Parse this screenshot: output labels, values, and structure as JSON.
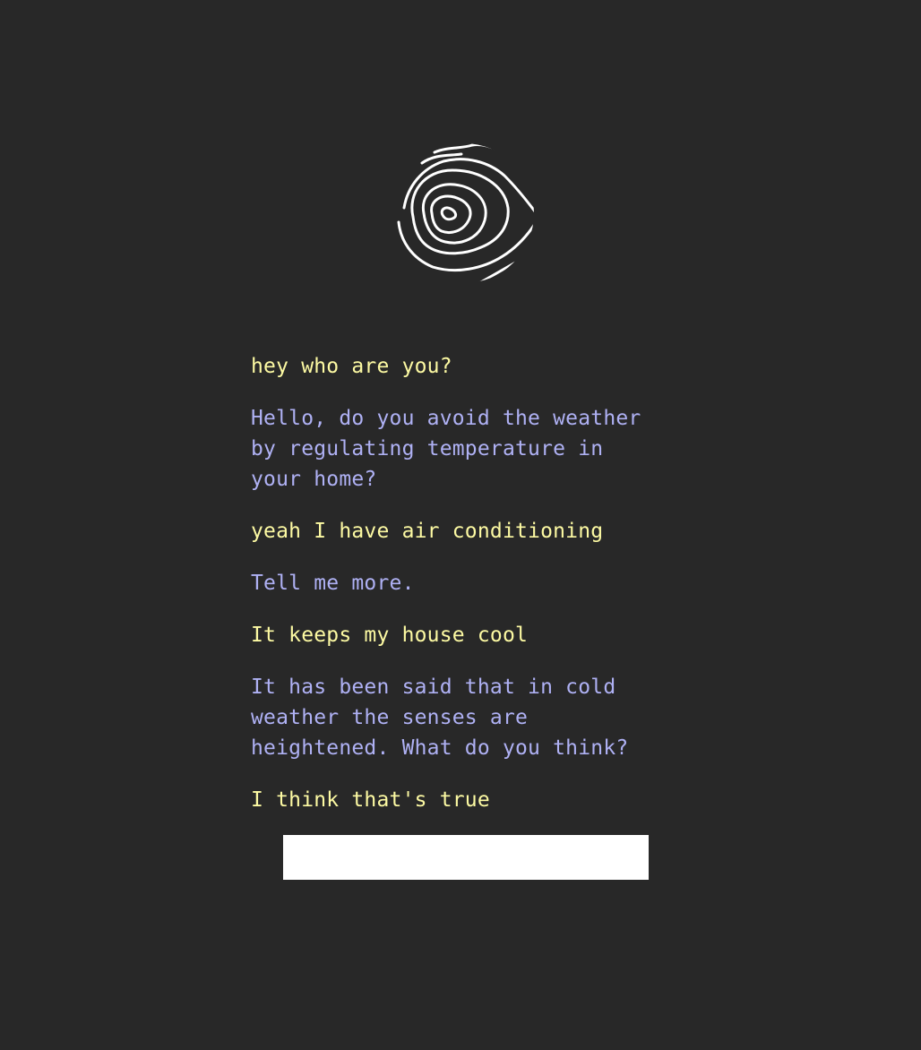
{
  "colors": {
    "background": "#282828",
    "user_text": "#fdfaa3",
    "bot_text": "#afb1f4",
    "input_background": "#ffffff"
  },
  "logo": {
    "icon": "topographic-contour-logo-icon"
  },
  "conversation": [
    {
      "role": "user",
      "text": "hey who are you?"
    },
    {
      "role": "bot",
      "text": "Hello, do you avoid the weather\nby regulating temperature in\nyour home?"
    },
    {
      "role": "user",
      "text": "yeah I have air conditioning"
    },
    {
      "role": "bot",
      "text": "Tell me more."
    },
    {
      "role": "user",
      "text": "It keeps my house cool"
    },
    {
      "role": "bot",
      "text": "It has been said that in cold\nweather the senses are\nheightened. What do you think?"
    },
    {
      "role": "user",
      "text": "I think that's true"
    }
  ],
  "input": {
    "value": "",
    "placeholder": ""
  }
}
